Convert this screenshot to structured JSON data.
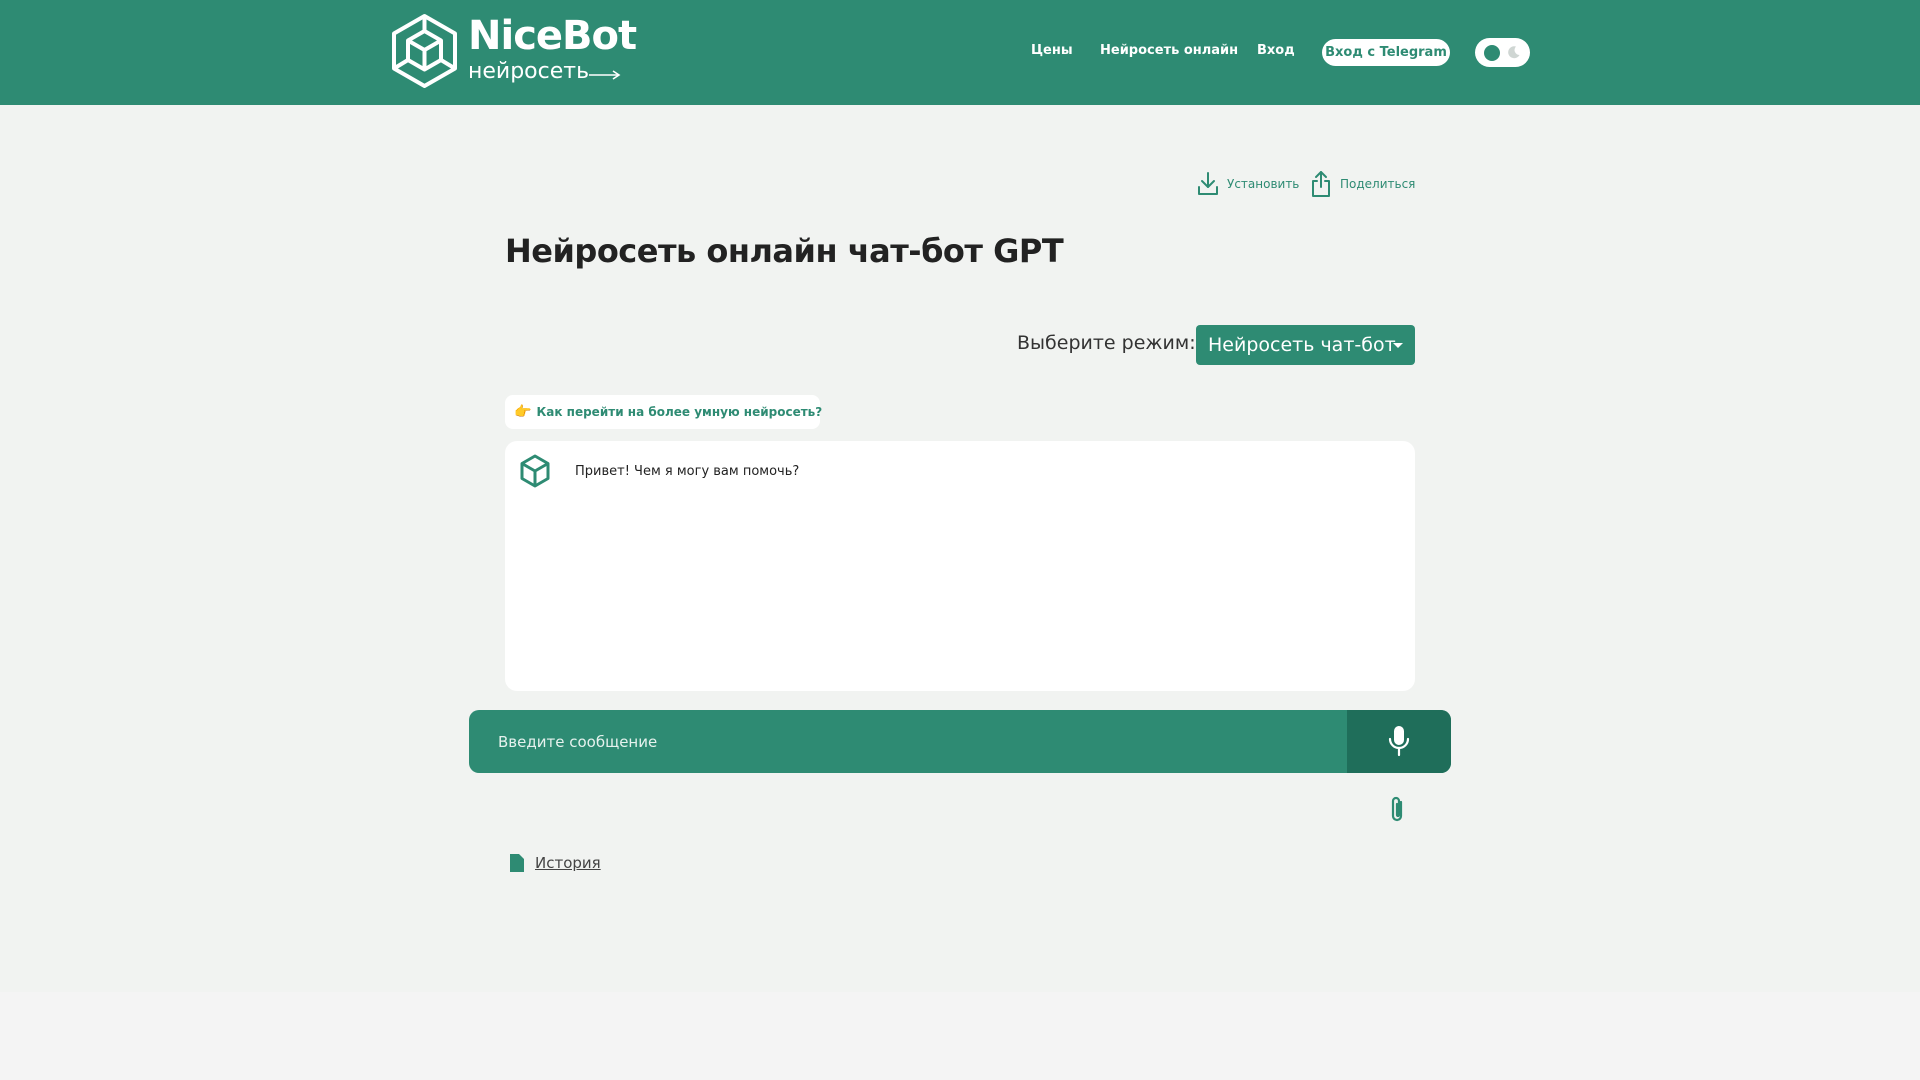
{
  "header": {
    "logo_title": "NiceBot",
    "logo_subtitle": "нейросеть",
    "nav": [
      "Цены",
      "Нейросеть онлайн",
      "Вход"
    ],
    "telegram_button": "Вход с Telegram",
    "theme_toggle": {
      "state": "light",
      "icon": "moon-icon"
    }
  },
  "actions": {
    "install_label": "Установить",
    "share_label": "Поделиться"
  },
  "page_title": "Нейросеть онлайн чат-бот GPT",
  "mode": {
    "label": "Выберите режим:",
    "selected": "Нейросеть чат-бот"
  },
  "hint": {
    "emoji": "👉",
    "text": "Как перейти на более умную нейросеть?"
  },
  "chat": {
    "messages": [
      {
        "sender": "bot",
        "text": "Привет! Чем я могу вам помочь?"
      }
    ]
  },
  "input": {
    "placeholder": "Введите сообщение",
    "value": ""
  },
  "history_label": "История",
  "colors": {
    "brand": "#2e8b73",
    "brand_dark": "#1f6e5a",
    "background": "#f1f3f1"
  }
}
